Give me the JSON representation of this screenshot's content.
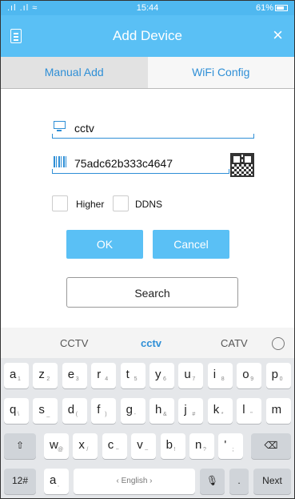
{
  "status_bar": {
    "signal": ".ıl .ıl ≈",
    "time": "15:44",
    "battery": "61%"
  },
  "app_bar": {
    "title": "Add Device",
    "close": "×"
  },
  "tabs": [
    {
      "label": "Manual Add"
    },
    {
      "label": "WiFi Config"
    }
  ],
  "form": {
    "device_name": "cctv",
    "serial": "75adc62b333c4647",
    "checkbox_higher": "Higher",
    "checkbox_ddns": "DDNS",
    "ok": "OK",
    "cancel": "Cancel",
    "search": "Search"
  },
  "keyboard": {
    "suggestions": [
      "CCTV",
      "cctv",
      "CATV"
    ],
    "row1": [
      [
        "a",
        "1"
      ],
      [
        "z",
        "2"
      ],
      [
        "e",
        "3"
      ],
      [
        "r",
        "4"
      ],
      [
        "t",
        "5"
      ],
      [
        "y",
        "6"
      ],
      [
        "u",
        "7"
      ],
      [
        "i",
        "8"
      ],
      [
        "o",
        "9"
      ],
      [
        "p",
        "0"
      ]
    ],
    "row2": [
      [
        "q",
        "\\"
      ],
      [
        "s",
        "_"
      ],
      [
        "d",
        "("
      ],
      [
        "f",
        ")"
      ],
      [
        "g",
        "-"
      ],
      [
        "h",
        "&"
      ],
      [
        "j",
        "#"
      ],
      [
        "k",
        "*"
      ],
      [
        "l",
        "\""
      ],
      [
        "m",
        ""
      ]
    ],
    "row3": [
      [
        "w",
        "@"
      ],
      [
        "x",
        "/"
      ],
      [
        "c",
        "~"
      ],
      [
        "v",
        "–"
      ],
      [
        "b",
        "!"
      ],
      [
        "n",
        "?"
      ],
      [
        "'",
        ";"
      ]
    ],
    "shift": "⇧",
    "backspace": "⌫",
    "numeric": "12#",
    "comma_key": "a",
    "space_label": "‹ English ›",
    "mic": "🎙",
    "period": ".",
    "next": "Next"
  },
  "colors": {
    "accent": "#5ac0f5",
    "link_blue": "#2f8fd6"
  }
}
